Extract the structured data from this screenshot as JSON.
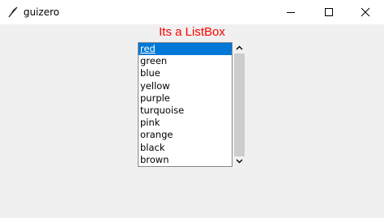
{
  "window": {
    "title": "guizero",
    "app_icon": "feather-icon",
    "controls": [
      "minimize-icon",
      "maximize-icon",
      "close-icon"
    ]
  },
  "heading": {
    "text": "Its a ListBox",
    "color": "#ff0000"
  },
  "listbox": {
    "items": [
      "red",
      "green",
      "blue",
      "yellow",
      "purple",
      "turquoise",
      "pink",
      "orange",
      "black",
      "brown"
    ],
    "selected": "red",
    "selection_color": "#0078d7"
  },
  "scrollbar": {
    "up_icon": "chevron-up-icon",
    "down_icon": "chevron-down-icon"
  }
}
